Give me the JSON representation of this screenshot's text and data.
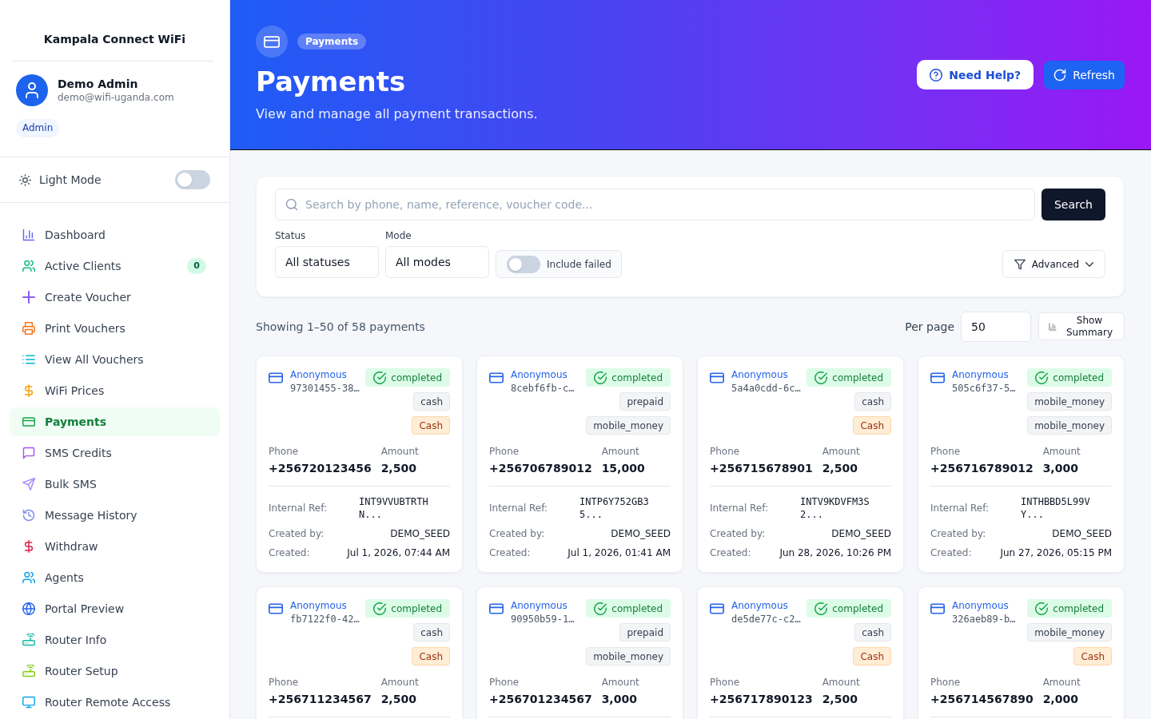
{
  "sidebar": {
    "brand": "Kampala Connect WiFi",
    "user": {
      "name": "Demo Admin",
      "email": "demo@wifi-uganda.com",
      "role": "Admin"
    },
    "theme_toggle": {
      "label": "Light Mode",
      "on": false
    },
    "nav": [
      {
        "label": "Dashboard",
        "selected": false
      },
      {
        "label": "Active Clients",
        "selected": false,
        "badge": "0"
      },
      {
        "label": "Create Voucher",
        "selected": false
      },
      {
        "label": "Print Vouchers",
        "selected": false
      },
      {
        "label": "View All Vouchers",
        "selected": false
      },
      {
        "label": "WiFi Prices",
        "selected": false
      },
      {
        "label": "Payments",
        "selected": true
      },
      {
        "label": "SMS Credits",
        "selected": false
      },
      {
        "label": "Bulk SMS",
        "selected": false
      },
      {
        "label": "Message History",
        "selected": false
      },
      {
        "label": "Withdraw",
        "selected": false
      },
      {
        "label": "Agents",
        "selected": false
      },
      {
        "label": "Portal Preview",
        "selected": false
      },
      {
        "label": "Router Info",
        "selected": false
      },
      {
        "label": "Router Setup",
        "selected": false
      },
      {
        "label": "Router Remote Access",
        "selected": false
      }
    ]
  },
  "header": {
    "badge": "Payments",
    "title": "Payments",
    "subtitle": "View and manage all payment transactions.",
    "buttons": [
      {
        "label": "Need Help?",
        "kind": "light"
      },
      {
        "label": "Refresh",
        "kind": "primary"
      }
    ]
  },
  "filters": {
    "search": {
      "placeholder": "Search by phone, name, reference, voucher code..."
    },
    "search_button": "Search",
    "status": {
      "label": "Status",
      "value": "All statuses"
    },
    "mode": {
      "label": "Mode",
      "value": "All modes"
    },
    "include_failed": {
      "label": "Include failed",
      "on": false
    },
    "advanced_button": "Advanced"
  },
  "results": {
    "summary": "Showing 1–50 of 58 payments",
    "per_page": {
      "label": "Per page",
      "value": "50"
    },
    "summary_button": "Show Summary"
  },
  "payments": [
    {
      "name": "Anonymous",
      "id": "97301455-38…",
      "status": "completed",
      "tags": [
        {
          "label": "cash",
          "kind": "neutral"
        },
        {
          "label": "Cash",
          "kind": "warning"
        }
      ],
      "phone": {
        "label": "Phone",
        "value": "+256720123456"
      },
      "amount": {
        "label": "Amount",
        "value": "2,500"
      },
      "details": [
        {
          "label": "Internal Ref:",
          "value": "INT9VVUBTRTHN...",
          "kind": "reference"
        },
        {
          "label": "Created by:",
          "value": "DEMO_SEED",
          "kind": "text"
        },
        {
          "label": "Created:",
          "value": "Jul 1, 2026, 07:44 AM",
          "kind": "text"
        }
      ]
    },
    {
      "name": "Anonymous",
      "id": "8cebf6fb-c…",
      "status": "completed",
      "tags": [
        {
          "label": "prepaid",
          "kind": "neutral"
        },
        {
          "label": "mobile_money",
          "kind": "neutral"
        }
      ],
      "phone": {
        "label": "Phone",
        "value": "+256706789012"
      },
      "amount": {
        "label": "Amount",
        "value": "15,000"
      },
      "details": [
        {
          "label": "Internal Ref:",
          "value": "INTP6Y752GB35...",
          "kind": "reference"
        },
        {
          "label": "Created by:",
          "value": "DEMO_SEED",
          "kind": "text"
        },
        {
          "label": "Created:",
          "value": "Jul 1, 2026, 01:41 AM",
          "kind": "text"
        }
      ]
    },
    {
      "name": "Anonymous",
      "id": "5a4a0cdd-6c…",
      "status": "completed",
      "tags": [
        {
          "label": "cash",
          "kind": "neutral"
        },
        {
          "label": "Cash",
          "kind": "warning"
        }
      ],
      "phone": {
        "label": "Phone",
        "value": "+256715678901"
      },
      "amount": {
        "label": "Amount",
        "value": "2,500"
      },
      "details": [
        {
          "label": "Internal Ref:",
          "value": "INTV9KDVFM3S2...",
          "kind": "reference"
        },
        {
          "label": "Created by:",
          "value": "DEMO_SEED",
          "kind": "text"
        },
        {
          "label": "Created:",
          "value": "Jun 28, 2026, 10:26 PM",
          "kind": "text"
        }
      ]
    },
    {
      "name": "Anonymous",
      "id": "505c6f37-5…",
      "status": "completed",
      "tags": [
        {
          "label": "mobile_money",
          "kind": "neutral"
        },
        {
          "label": "mobile_money",
          "kind": "neutral"
        }
      ],
      "phone": {
        "label": "Phone",
        "value": "+256716789012"
      },
      "amount": {
        "label": "Amount",
        "value": "3,000"
      },
      "details": [
        {
          "label": "Internal Ref:",
          "value": "INTHBBD5L99VY...",
          "kind": "reference"
        },
        {
          "label": "Created by:",
          "value": "DEMO_SEED",
          "kind": "text"
        },
        {
          "label": "Created:",
          "value": "Jun 27, 2026, 05:15 PM",
          "kind": "text"
        }
      ]
    },
    {
      "name": "Anonymous",
      "id": "fb7122f0-42…",
      "status": "completed",
      "tags": [
        {
          "label": "cash",
          "kind": "neutral"
        },
        {
          "label": "Cash",
          "kind": "warning"
        }
      ],
      "phone": {
        "label": "Phone",
        "value": "+256711234567"
      },
      "amount": {
        "label": "Amount",
        "value": "2,500"
      }
    },
    {
      "name": "Anonymous",
      "id": "90950b59-1…",
      "status": "completed",
      "tags": [
        {
          "label": "prepaid",
          "kind": "neutral"
        },
        {
          "label": "mobile_money",
          "kind": "neutral"
        }
      ],
      "phone": {
        "label": "Phone",
        "value": "+256701234567"
      },
      "amount": {
        "label": "Amount",
        "value": "3,000"
      }
    },
    {
      "name": "Anonymous",
      "id": "de5de77c-c2…",
      "status": "completed",
      "tags": [
        {
          "label": "cash",
          "kind": "neutral"
        },
        {
          "label": "Cash",
          "kind": "warning"
        }
      ],
      "phone": {
        "label": "Phone",
        "value": "+256717890123"
      },
      "amount": {
        "label": "Amount",
        "value": "2,500"
      }
    },
    {
      "name": "Anonymous",
      "id": "326aeb89-b…",
      "status": "completed",
      "tags": [
        {
          "label": "mobile_money",
          "kind": "neutral"
        },
        {
          "label": "Cash",
          "kind": "warning"
        }
      ],
      "phone": {
        "label": "Phone",
        "value": "+256714567890"
      },
      "amount": {
        "label": "Amount",
        "value": "2,000"
      }
    }
  ]
}
